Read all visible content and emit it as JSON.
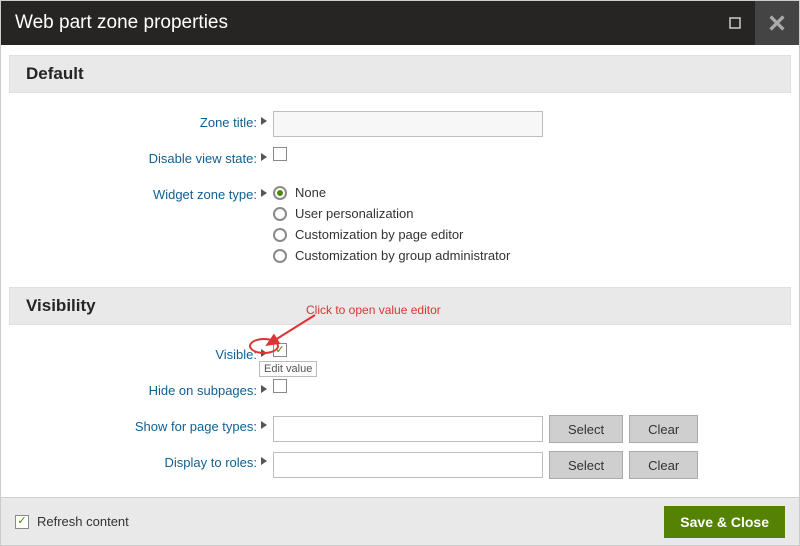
{
  "title": "Web part zone properties",
  "sections": {
    "default": {
      "header": "Default",
      "zone_title_label": "Zone title:",
      "zone_title_value": "",
      "disable_view_state_label": "Disable view state:",
      "widget_zone_type_label": "Widget zone type:",
      "widget_zone_options": [
        "None",
        "User personalization",
        "Customization by page editor",
        "Customization by group administrator"
      ],
      "widget_zone_selected": 0
    },
    "visibility": {
      "header": "Visibility",
      "visible_label": "Visible:",
      "hide_on_subpages_label": "Hide on subpages:",
      "show_for_page_types_label": "Show for page types:",
      "display_to_roles_label": "Display to roles:",
      "select_label": "Select",
      "clear_label": "Clear",
      "show_for_page_types_value": "",
      "display_to_roles_value": ""
    }
  },
  "footer": {
    "refresh_label": "Refresh content",
    "save_label": "Save & Close"
  },
  "annotations": {
    "hint": "Click to open value editor",
    "tooltip": "Edit value"
  }
}
